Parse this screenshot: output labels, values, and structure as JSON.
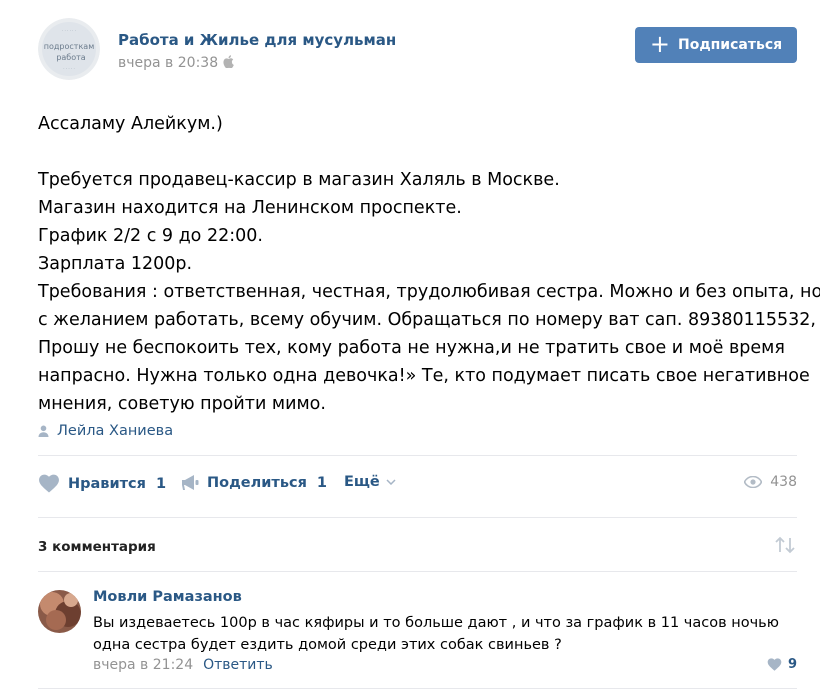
{
  "header": {
    "group_name": "Работа и Жилье для мусульман",
    "post_time": "вчера в 20:38",
    "subscribe_label": "Подписаться",
    "avatar_caption": "подросткам работа"
  },
  "post": {
    "greeting": "Ассаламу Алейкум.)",
    "lines": [
      "Требуется продавец-кассир в магазин Халяль в Москве.",
      "Магазин находится на Ленинском проспекте.",
      "График 2/2 с 9 до 22:00.",
      "Зарплата 1200р.",
      "Требования : ответственная, честная, трудолюбивая сестра. Можно и без опыта, но",
      "с желанием работать, всему обучим. Обращаться по номеру ват сап. 89380115532,",
      "Прошу не беспокоить тех, кому работа не нужна,и не тратить свое и моё время",
      "напрасно. Нужна только одна девочка!» Те, кто подумает писать свое негативное",
      "мнения, советую пройти мимо."
    ],
    "signer": "Лейла Ханиева"
  },
  "actions": {
    "like_label": "Нравится",
    "like_count": "1",
    "share_label": "Поделиться",
    "share_count": "1",
    "more_label": "Ещё",
    "views_count": "438"
  },
  "comments": {
    "count_label": "3 комментария",
    "items": [
      {
        "author": "Мовли Рамазанов",
        "text_lines": [
          "Вы издеваетесь 100р в час кяфиры и то больше дают , и что за график в 11 часов ночью",
          "одна сестра будет ездить домой среди этих собак свиньев ?"
        ],
        "time": "вчера в 21:24",
        "reply_label": "Ответить",
        "likes": "9"
      }
    ]
  },
  "colors": {
    "link": "#2a5885",
    "button": "#5181b8",
    "muted": "#939393",
    "divider": "#e7e8ec"
  }
}
